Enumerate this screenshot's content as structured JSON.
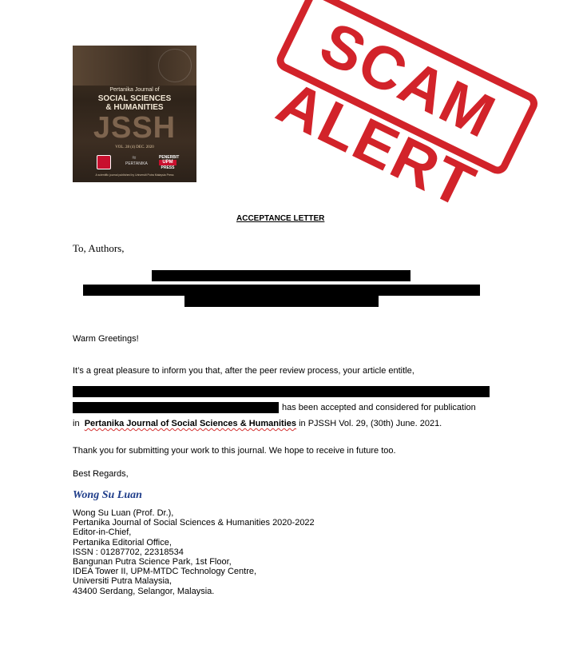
{
  "cover": {
    "journal_line1": "Pertanika Journal of",
    "journal_line2a": "SOCIAL SCIENCES",
    "journal_line2b": "& HUMANITIES",
    "abbrev": "JSSH",
    "volume": "VOL. 28 (4) DEC. 2020",
    "logo_b": "PERTANIKA",
    "logo_c_top": "PENERBIT",
    "logo_c_mid": "UPM",
    "logo_c_bottom": "PRESS",
    "published": "A scientific journal published by Universiti Putra Malaysia Press"
  },
  "stamp": {
    "text": "SCAM ALERT"
  },
  "letter": {
    "heading": "ACCEPTANCE LETTER",
    "salutation": "To, Authors,",
    "greeting": "Warm Greetings!",
    "intro": "It’s a great pleasure to inform you that, after the peer review process, your article entitle,",
    "accepted": "has been accepted and considered for publication",
    "in_word": "in",
    "journal": "Pertanika Journal of Social Sciences & Humanities",
    "issue": "in PJSSH Vol. 29, (30th) June. 2021.",
    "thanks": "Thank you for submitting your work to this journal. We hope to receive in future too.",
    "regards": "Best Regards,",
    "signature": "Wong Su Luan",
    "sig_lines": [
      "Wong Su Luan (Prof. Dr.),",
      "Pertanika Journal of Social Sciences & Humanities 2020-2022",
      "Editor-in-Chief,",
      "Pertanika Editorial Office,",
      "ISSN : 01287702, 22318534",
      "Bangunan Putra Science Park, 1st Floor,",
      "IDEA Tower II, UPM-MTDC Technology Centre,",
      "Universiti Putra Malaysia,",
      "43400 Serdang, Selangor, Malaysia."
    ]
  }
}
